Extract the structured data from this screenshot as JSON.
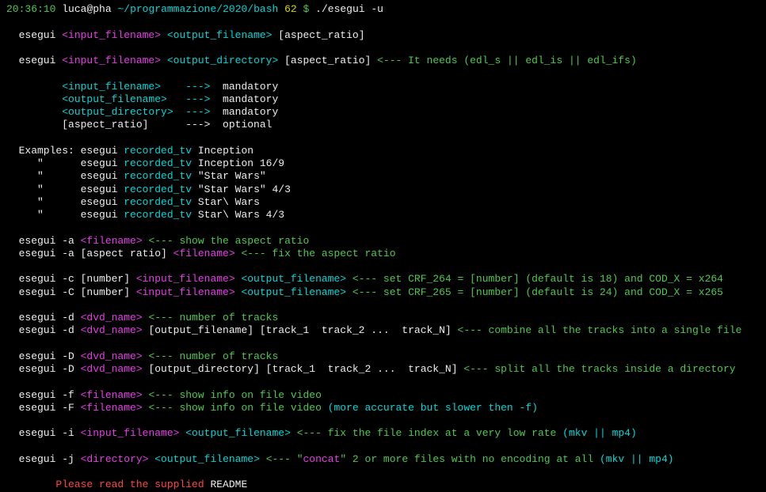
{
  "prompt": {
    "time": "20:36:10",
    "user_host": "luca@pha",
    "path": "~/programmazione/2020/bash",
    "num": "62",
    "dollar": "$",
    "cmd": "./esegui -u"
  },
  "u1": {
    "p": "  esegui ",
    "a1": "<input_filename>",
    "a2": " <output_filename>",
    "a3": " [aspect_ratio]"
  },
  "u2": {
    "p": "  esegui ",
    "a1": "<input_filename>",
    "a2": " <output_directory>",
    "a3": " [aspect_ratio]",
    "c": " <--- It needs (edl_s || edl_is || edl_ifs)"
  },
  "params": {
    "l1a": "         <input_filename>    --->  ",
    "l1b": "mandatory",
    "l2a": "         <output_filename>   --->  ",
    "l2b": "mandatory",
    "l3a": "         <output_directory>  --->  ",
    "l3b": "mandatory",
    "l4a": "         [aspect_ratio]      --->  ",
    "l4b": "optional"
  },
  "ex": {
    "h": "  Examples: esegui ",
    "q": "     \"      esegui ",
    "r": "recorded_tv",
    "e1": " Inception",
    "e2": " Inception 16/9",
    "e3": " \"Star Wars\"",
    "e4": " \"Star Wars\" 4/3",
    "e5": " Star\\ Wars",
    "e6": " Star\\ Wars 4/3"
  },
  "a": {
    "l1a": "  esegui -a ",
    "l1b": "<filename>",
    "l1c": " <--- show the aspect ratio",
    "l2a": "  esegui -a [aspect ratio] ",
    "l2b": "<filename>",
    "l2c": " <--- fix the aspect ratio"
  },
  "c": {
    "l1a": "  esegui -c [number] ",
    "l1b": "<input_filename>",
    "l1c": " <output_filename>",
    "l1d": " <--- set CRF_264 = [number] (default is 18) and COD_X = x264",
    "l2a": "  esegui -C [number] ",
    "l2b": "<input_filename>",
    "l2c": " <output_filename>",
    "l2d": " <--- set CRF_265 = [number] (default is 24) and COD_X = x265"
  },
  "d": {
    "l1a": "  esegui -d ",
    "l1b": "<dvd_name>",
    "l1c": " <--- number of tracks",
    "l2a": "  esegui -d ",
    "l2b": "<dvd_name>",
    "l2c": " [output_filename] [track_1  track_2 ...  track_N]",
    "l2d": " <--- combine all the tracks into a single file"
  },
  "D": {
    "l1a": "  esegui -D ",
    "l1b": "<dvd_name>",
    "l1c": " <--- number of tracks",
    "l2a": "  esegui -D ",
    "l2b": "<dvd_name>",
    "l2c": " [output_directory] [track_1  track_2 ...  track_N]",
    "l2d": " <--- split all the tracks inside a directory"
  },
  "f": {
    "l1a": "  esegui -f ",
    "l1b": "<filename>",
    "l1c": " <--- show info on file video",
    "l2a": "  esegui -F ",
    "l2b": "<filename>",
    "l2c": " <--- show info on file video",
    "l2d": " (more accurate but slower then -f)"
  },
  "i": {
    "a": "  esegui -i ",
    "b": "<input_filename>",
    "c": " <output_filename>",
    "d": " <--- fix the file index at a very low rate",
    "e": " (mkv || mp4)"
  },
  "j": {
    "a": "  esegui -j ",
    "b": "<directory>",
    "c": " <output_filename>",
    "d1": " <--- \"",
    "d2": "concat",
    "d3": "\" 2 or more files with no encoding at all",
    "e": " (mkv || mp4)"
  },
  "readme": {
    "a": "        Please read the supplied ",
    "b": "README"
  }
}
